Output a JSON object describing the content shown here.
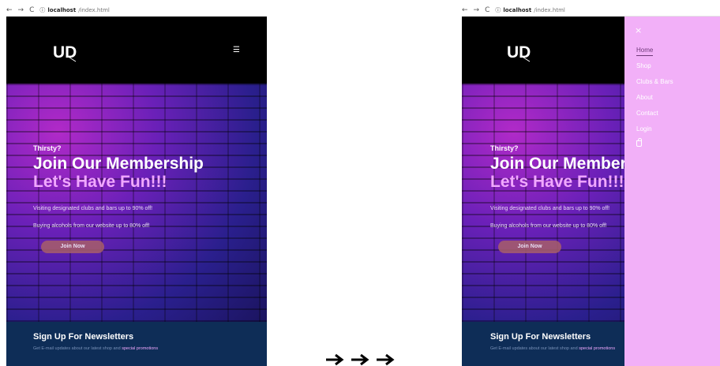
{
  "browser": {
    "back_glyph": "←",
    "forward_glyph": "→",
    "reload_glyph": "C",
    "info_glyph": "ⓘ",
    "url_host": "localhost",
    "url_path": "/index.html"
  },
  "header": {
    "logo_alt": "UD",
    "menu_icon": "menu-toggle-icon"
  },
  "hero": {
    "eyebrow": "Thirsty?",
    "headline_line1": "Join Our Membership",
    "headline_line2": "Let's Have Fun!!!",
    "promo1": "Visiting designated clubs and bars up to 90% off!",
    "promo2": "Buying alcohols from our website up to 80% off!",
    "cta": "Join Now"
  },
  "newsletter": {
    "title": "Sign Up For Newsletters",
    "subtitle_prefix": "Get E-mail updates about our latest shop and",
    "subtitle_highlight": "special promotions"
  },
  "drawer": {
    "close_glyph": "×",
    "items": [
      {
        "label": "Home"
      },
      {
        "label": "Shop"
      },
      {
        "label": "Clubs & Bars"
      },
      {
        "label": "About"
      },
      {
        "label": "Contact"
      },
      {
        "label": "Login"
      }
    ]
  },
  "colors": {
    "drawer_bg": "#f2b0f8",
    "accent_pink": "#f1a8ff",
    "newsletter_bg": "#0e2d57",
    "cta_bg": "#a85f6a"
  }
}
